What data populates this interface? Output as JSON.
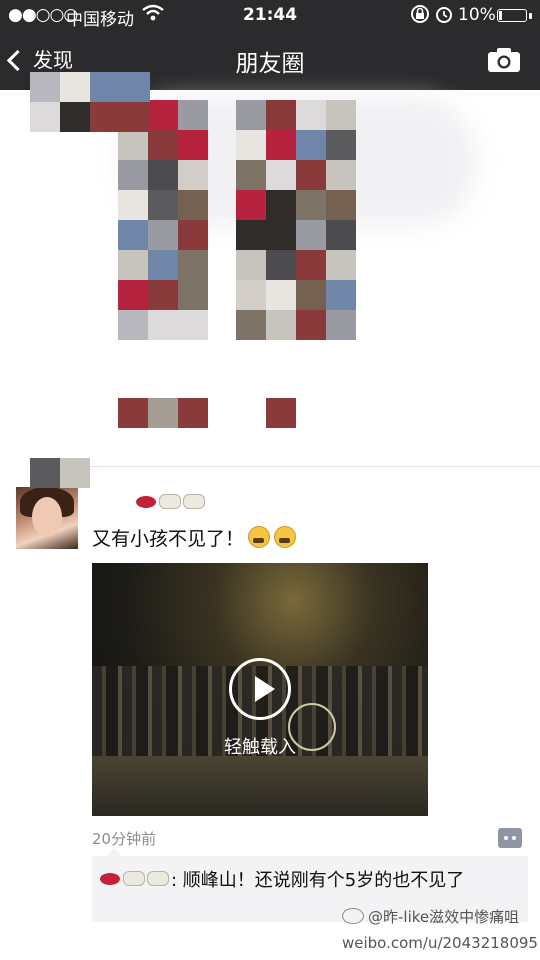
{
  "status_bar": {
    "signal": "●●○○○",
    "carrier": "中国移动",
    "time": "21:44",
    "battery_percent": "10%",
    "battery_level": 0.1,
    "icons": [
      "signal-icon",
      "wifi-icon",
      "lock-rotation-icon",
      "alarm-icon",
      "battery-icon"
    ]
  },
  "nav": {
    "back_label": "发现",
    "title": "朋友圈",
    "camera_icon": "camera-icon"
  },
  "post": {
    "user_name": "",
    "text": "又有小孩不见了！",
    "video_label": "轻触载入",
    "time": "20分钟前",
    "comment_author": "",
    "comment_text": ": 顺峰山！还说刚有个5岁的也不见了"
  },
  "watermark": {
    "name": "@昨-like滋效中惨痛咀",
    "url": "weibo.com/u/2043218095"
  },
  "colors": {
    "nav_bg": "#2b2b2d",
    "link_blue": "#576b95",
    "comment_bg": "#f3f3f5"
  }
}
